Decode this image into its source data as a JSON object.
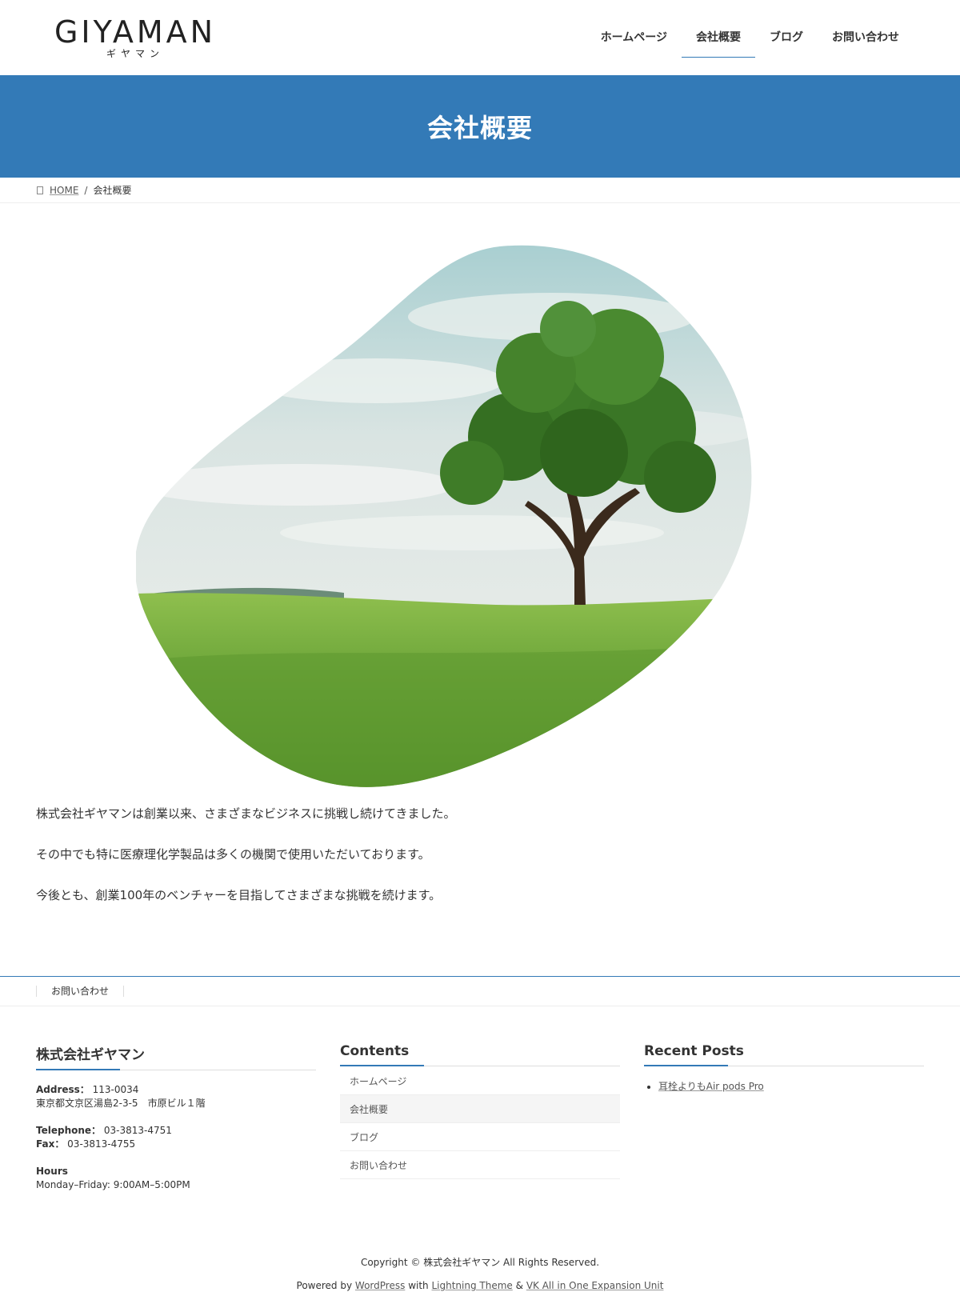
{
  "header": {
    "logo_text": "GIYAMAN",
    "logo_sub": "ギヤマン",
    "nav": [
      {
        "label": "ホームページ"
      },
      {
        "label": "会社概要"
      },
      {
        "label": "ブログ"
      },
      {
        "label": "お問い合わせ"
      }
    ]
  },
  "page": {
    "title": "会社概要"
  },
  "breadcrumb": {
    "home": "HOME",
    "separator": "/",
    "current": "会社概要"
  },
  "content": {
    "paragraphs": [
      "株式会社ギヤマンは創業以来、さまざまなビジネスに挑戦し続けてきました。",
      "その中でも特に医療理化学製品は多くの機関で使用いただいております。",
      "今後とも、創業100年のベンチャーを目指してさまざまな挑戦を続けます。"
    ]
  },
  "footer_nav": {
    "items": [
      "お問い合わせ"
    ]
  },
  "footer": {
    "company": {
      "title": "株式会社ギヤマン",
      "address_label": "Address：",
      "address_zip": "113-0034",
      "address_line": "東京都文京区湯島2-3-5　市原ビル１階",
      "telephone_label": "Telephone：",
      "telephone": "03-3813-4751",
      "fax_label": "Fax：",
      "fax": "03-3813-4755",
      "hours_label": "Hours",
      "hours": "Monday–Friday: 9:00AM–5:00PM"
    },
    "contents": {
      "title": "Contents",
      "items": [
        "ホームページ",
        "会社概要",
        "ブログ",
        "お問い合わせ"
      ]
    },
    "recent_posts": {
      "title": "Recent Posts",
      "items": [
        "耳栓よりもAir pods Pro"
      ]
    }
  },
  "copyright": {
    "line1": "Copyright © 株式会社ギヤマン All Rights Reserved.",
    "powered_by": "Powered by",
    "wordpress": "WordPress",
    "with": "with",
    "theme": "Lightning Theme",
    "amp": "&",
    "plugin": "VK All in One Expansion Unit"
  },
  "colors": {
    "accent": "#337ab7",
    "text": "#333333"
  },
  "icons": {
    "breadcrumb_home": "home-icon"
  }
}
